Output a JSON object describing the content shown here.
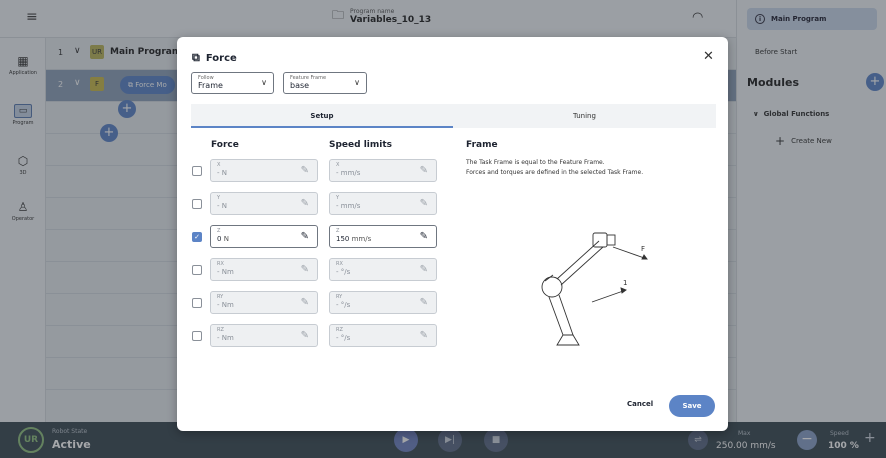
{
  "topbar": {
    "program_label": "Program name",
    "program_name": "Variables_10_13"
  },
  "leftnav": [
    {
      "label": "Application",
      "icon": "grid-icon"
    },
    {
      "label": "Program",
      "icon": "program-icon"
    },
    {
      "label": "3D",
      "icon": "cube-icon"
    },
    {
      "label": "Operator",
      "icon": "person-icon"
    }
  ],
  "tree": {
    "row1": {
      "num": "1",
      "title": "Main Program:"
    },
    "row2": {
      "num": "2",
      "chip": "Force Mo"
    }
  },
  "rightpanel": {
    "main_program": "Main Program",
    "before_start": "Before Start",
    "modules": "Modules",
    "global_functions": "Global Functions",
    "create_new": "Create New"
  },
  "bottombar": {
    "robot_state_label": "Robot State",
    "robot_state_value": "Active",
    "max_label": "Max",
    "max_value": "250.00 mm/s",
    "speed_label": "Speed",
    "speed_value": "100 %"
  },
  "modal": {
    "title": "Force",
    "follow": {
      "label": "Follow",
      "value": "Frame"
    },
    "feature_frame": {
      "label": "Feature Frame",
      "value": "base"
    },
    "tabs": [
      "Setup",
      "Tuning"
    ],
    "force_header": "Force",
    "speed_header": "Speed limits",
    "rows": [
      {
        "checked": false,
        "force": {
          "label": "X",
          "value": "-",
          "unit": "N"
        },
        "speed": {
          "label": "X",
          "value": "-",
          "unit": "mm/s"
        }
      },
      {
        "checked": false,
        "force": {
          "label": "Y",
          "value": "-",
          "unit": "N"
        },
        "speed": {
          "label": "Y",
          "value": "-",
          "unit": "mm/s"
        }
      },
      {
        "checked": true,
        "force": {
          "label": "Z",
          "value": "0",
          "unit": "N"
        },
        "speed": {
          "label": "Z",
          "value": "150",
          "unit": "mm/s"
        }
      },
      {
        "checked": false,
        "force": {
          "label": "RX",
          "value": "-",
          "unit": "Nm"
        },
        "speed": {
          "label": "RX",
          "value": "-",
          "unit": "°/s"
        }
      },
      {
        "checked": false,
        "force": {
          "label": "RY",
          "value": "-",
          "unit": "Nm"
        },
        "speed": {
          "label": "RY",
          "value": "-",
          "unit": "°/s"
        }
      },
      {
        "checked": false,
        "force": {
          "label": "RZ",
          "value": "-",
          "unit": "Nm"
        },
        "speed": {
          "label": "RZ",
          "value": "-",
          "unit": "°/s"
        }
      }
    ],
    "frame_header": "Frame",
    "frame_text_1": "The Task Frame is equal to the Feature Frame.",
    "frame_text_2": "Forces and torques are defined in the selected Task Frame.",
    "diagram_labels": {
      "f": "F",
      "one": "1"
    },
    "cancel": "Cancel",
    "save": "Save"
  },
  "colors": {
    "accent": "#5c84c6",
    "active_state": "#8fbf7f"
  }
}
